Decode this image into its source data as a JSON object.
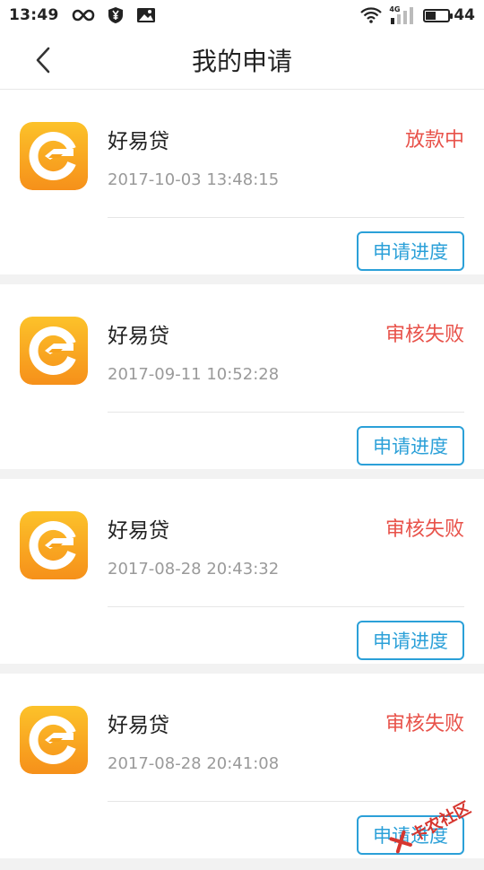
{
  "status_bar": {
    "time": "13:49",
    "icons": [
      "infinity-icon",
      "yen-shield-icon",
      "photo-icon"
    ],
    "network_label": "4G",
    "battery": "44",
    "battery_level_percent": 44
  },
  "header": {
    "title": "我的申请",
    "back_icon": "chevron-left-icon"
  },
  "colors": {
    "status_red": "#e8524a",
    "button_blue": "#2ba0d8",
    "logo_orange": "#f9a31b"
  },
  "applications": [
    {
      "name": "好易贷",
      "time": "2017-10-03 13:48:15",
      "status": "放款中",
      "button": "申请进度"
    },
    {
      "name": "好易贷",
      "time": "2017-09-11 10:52:28",
      "status": "审核失败",
      "button": "申请进度"
    },
    {
      "name": "好易贷",
      "time": "2017-08-28 20:43:32",
      "status": "审核失败",
      "button": "申请进度"
    },
    {
      "name": "好易贷",
      "time": "2017-08-28 20:41:08",
      "status": "审核失败",
      "button": "申请进度"
    }
  ],
  "watermark": {
    "text": "卡农社区"
  }
}
